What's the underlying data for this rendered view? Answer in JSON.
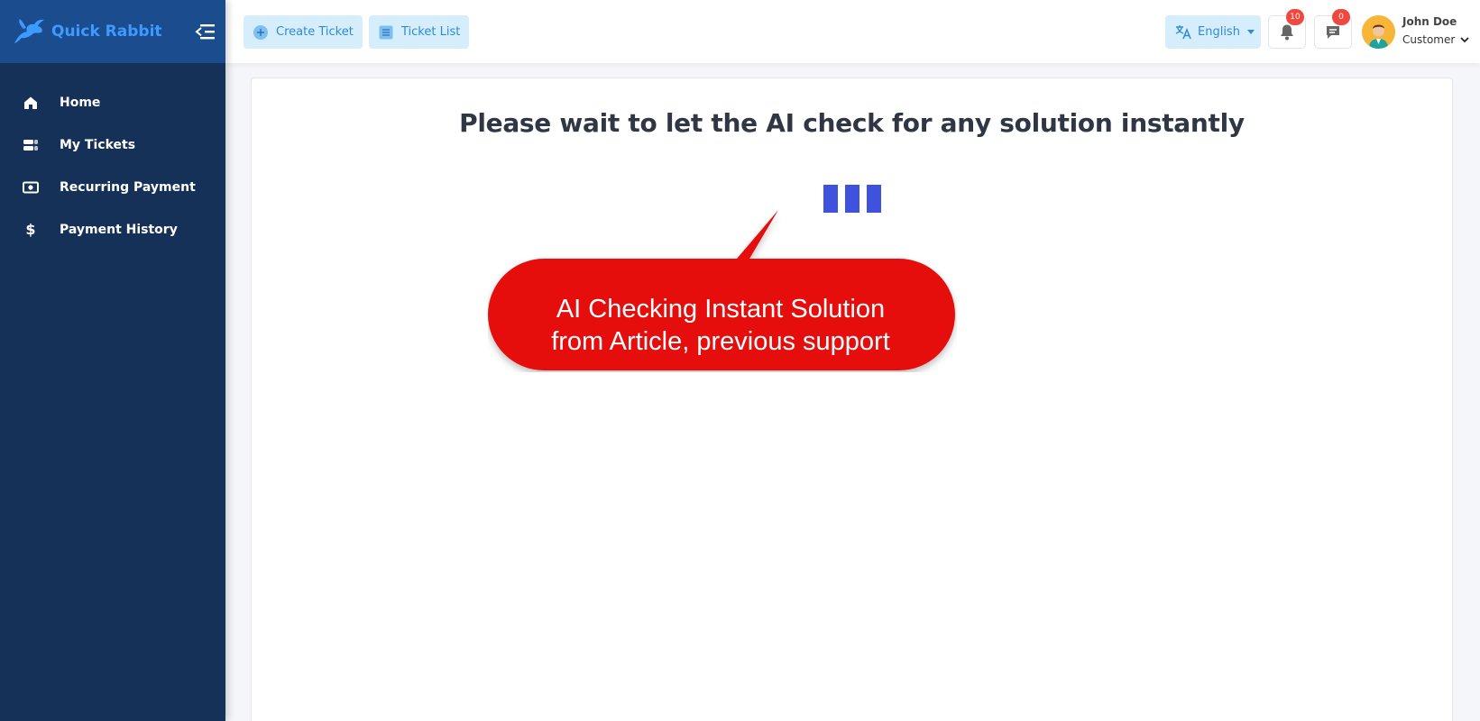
{
  "brand": {
    "name": "Quick Rabbit"
  },
  "sidebar": {
    "items": [
      {
        "label": "Home",
        "icon": "home-icon"
      },
      {
        "label": "My Tickets",
        "icon": "tickets-icon"
      },
      {
        "label": "Recurring Payment",
        "icon": "money-icon"
      },
      {
        "label": "Payment History",
        "icon": "dollar-icon"
      }
    ]
  },
  "topbar": {
    "create_ticket": "Create Ticket",
    "ticket_list": "Ticket List",
    "language": "English",
    "notifications_count": "10",
    "messages_count": "0",
    "user_name": "John Doe",
    "user_role": "Customer"
  },
  "main": {
    "title": "Please wait to let the AI check for any solution instantly",
    "callout_line1": "AI Checking Instant Solution",
    "callout_line2": "from Article, previous support"
  },
  "colors": {
    "sidebar_bg": "#163158",
    "sidebar_header_bg": "#1b4c8d",
    "accent": "#2d8bd6",
    "loader": "#3f52dd",
    "callout": "#e60a0a",
    "badge": "#f0483e"
  }
}
